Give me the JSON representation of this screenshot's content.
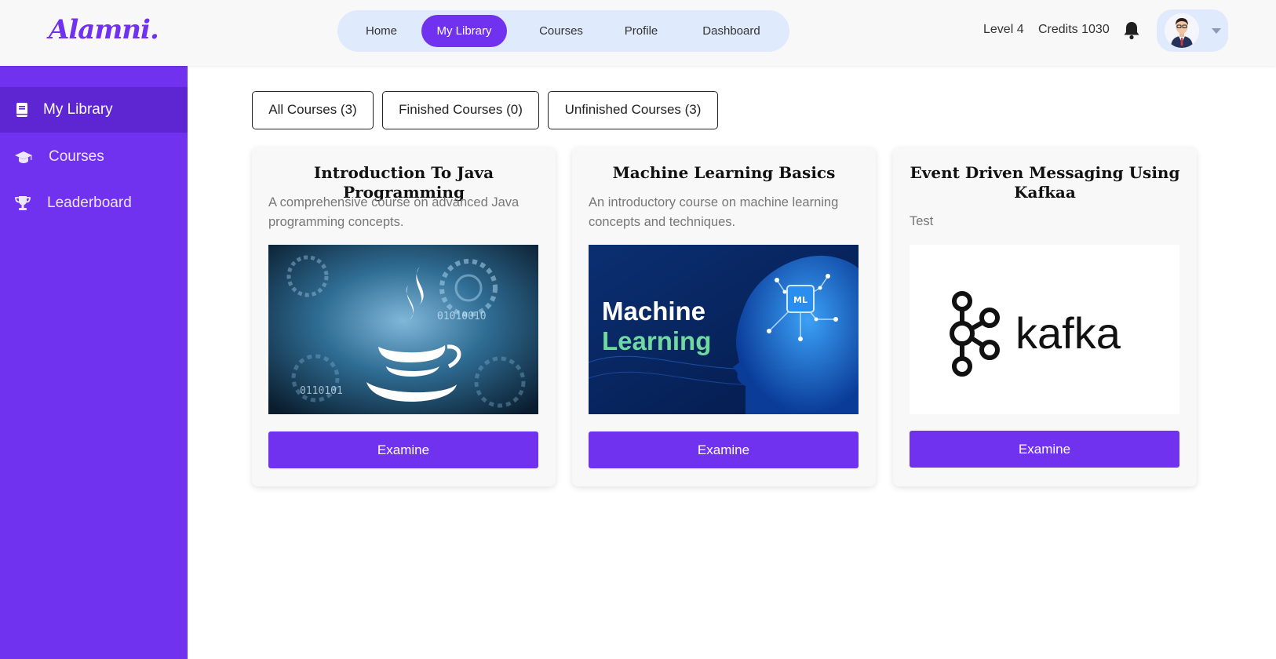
{
  "app": {
    "logo": "Alamni."
  },
  "nav": {
    "items": [
      {
        "label": "Home"
      },
      {
        "label": "My Library"
      },
      {
        "label": "Courses"
      },
      {
        "label": "Profile"
      },
      {
        "label": "Dashboard"
      }
    ],
    "active": "My Library"
  },
  "header": {
    "level": "Level 4",
    "credits": "Credits 1030"
  },
  "sidebar": {
    "items": [
      {
        "label": "My Library",
        "icon": "book-icon"
      },
      {
        "label": "Courses",
        "icon": "graduation-cap-icon"
      },
      {
        "label": "Leaderboard",
        "icon": "trophy-icon"
      }
    ]
  },
  "filters": [
    {
      "label": "All Courses (3)"
    },
    {
      "label": "Finished Courses (0)"
    },
    {
      "label": "Unfinished Courses (3)"
    }
  ],
  "courses": [
    {
      "title": "Introduction To Java Programming",
      "description": "A comprehensive course on advanced Java programming concepts.",
      "image": "java-logo-image",
      "button": "Examine"
    },
    {
      "title": "Machine Learning Basics",
      "description": "An introductory course on machine learning concepts and techniques.",
      "image": "machine-learning-image",
      "image_text": {
        "line1": "Machine",
        "line2": "Learning",
        "chip": "ML"
      },
      "button": "Examine"
    },
    {
      "title": "Event Driven Messaging Using Kafkaa",
      "description": "Test",
      "image": "kafka-logo-image",
      "image_text": {
        "wordmark": "kafka"
      },
      "button": "Examine"
    }
  ],
  "colors": {
    "accent": "#7132f0",
    "sidebar_active": "#5e25d2",
    "nav_bg": "#dfeafc",
    "ml_green": "#6fd9a0"
  }
}
